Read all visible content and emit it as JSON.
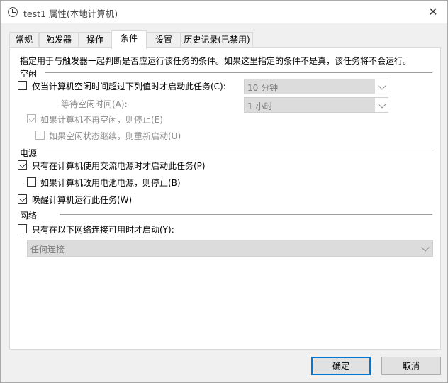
{
  "window": {
    "title": "test1 属性(本地计算机)",
    "close_glyph": "✕"
  },
  "tabs": [
    {
      "label": "常规"
    },
    {
      "label": "触发器"
    },
    {
      "label": "操作"
    },
    {
      "label": "条件"
    },
    {
      "label": "设置"
    },
    {
      "label": "历史记录(已禁用)"
    }
  ],
  "active_tab": "条件",
  "description": "指定用于与触发器一起判断是否应运行该任务的条件。如果这里指定的条件不是真，该任务将不会运行。",
  "idle": {
    "section_label": "空闲",
    "start_only_if_idle": {
      "label": "仅当计算机空闲时间超过下列值时才启动此任务(C):",
      "checked": false
    },
    "idle_duration": {
      "value": "10 分钟"
    },
    "wait_label": "等待空闲时间(A):",
    "wait_duration": {
      "value": "1 小时"
    },
    "stop_if_not_idle": {
      "label": "如果计算机不再空闲，则停止(E)",
      "checked": true
    },
    "restart_if_idle": {
      "label": "如果空闲状态继续，则重新启动(U)",
      "checked": false
    }
  },
  "power": {
    "section_label": "电源",
    "ac_only": {
      "label": "只有在计算机使用交流电源时才启动此任务(P)",
      "checked": true
    },
    "stop_on_battery": {
      "label": "如果计算机改用电池电源，则停止(B)",
      "checked": false
    },
    "wake_to_run": {
      "label": "唤醒计算机运行此任务(W)",
      "checked": true
    }
  },
  "network": {
    "section_label": "网络",
    "only_if_network": {
      "label": "只有在以下网络连接可用时才启动(Y):",
      "checked": false
    },
    "connection": {
      "value": "任何连接"
    }
  },
  "buttons": {
    "ok": "确定",
    "cancel": "取消"
  },
  "colors": {
    "accent": "#0078d7",
    "panel_bg": "#ffffff",
    "window_bg": "#f0f0f0"
  }
}
